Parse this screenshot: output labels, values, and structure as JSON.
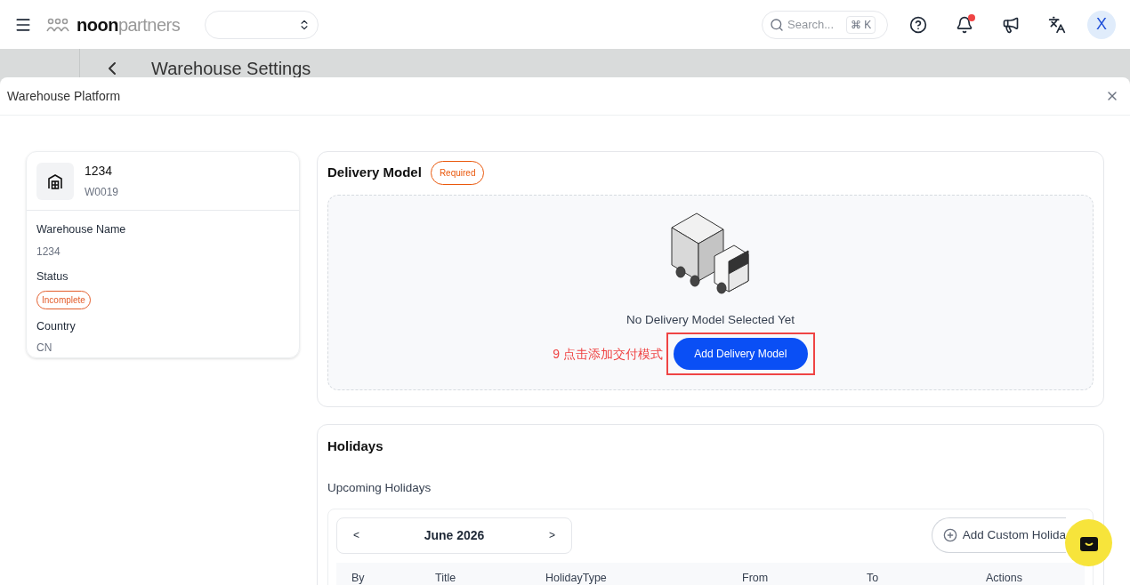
{
  "topbar": {
    "brand_bold": "noon",
    "brand_light": "partners",
    "search_placeholder": "Search...",
    "shortcut": "⌘ K",
    "notification_badge": true,
    "avatar": "X"
  },
  "background_page": {
    "title": "Warehouse Settings"
  },
  "modal": {
    "title": "Warehouse Platform"
  },
  "warehouse_card": {
    "name": "1234",
    "code": "W0019",
    "fields": [
      {
        "kind": "text",
        "label": "Warehouse Name",
        "value": "1234"
      },
      {
        "kind": "badge",
        "label": "Status",
        "value": "Incomplete"
      },
      {
        "kind": "text",
        "label": "Country",
        "value": "CN"
      }
    ]
  },
  "delivery_model": {
    "title": "Delivery Model",
    "badge": "Required",
    "empty_text": "No Delivery Model Selected Yet",
    "button": "Add Delivery Model",
    "annotation": "9 点击添加交付模式"
  },
  "holidays": {
    "title": "Holidays",
    "subtitle": "Upcoming Holidays",
    "prev": "<",
    "month": "June 2026",
    "next": ">",
    "add_button": "Add Custom Holida",
    "columns": [
      "By",
      "Title",
      "HolidayType",
      "From",
      "To",
      "Actions"
    ]
  }
}
